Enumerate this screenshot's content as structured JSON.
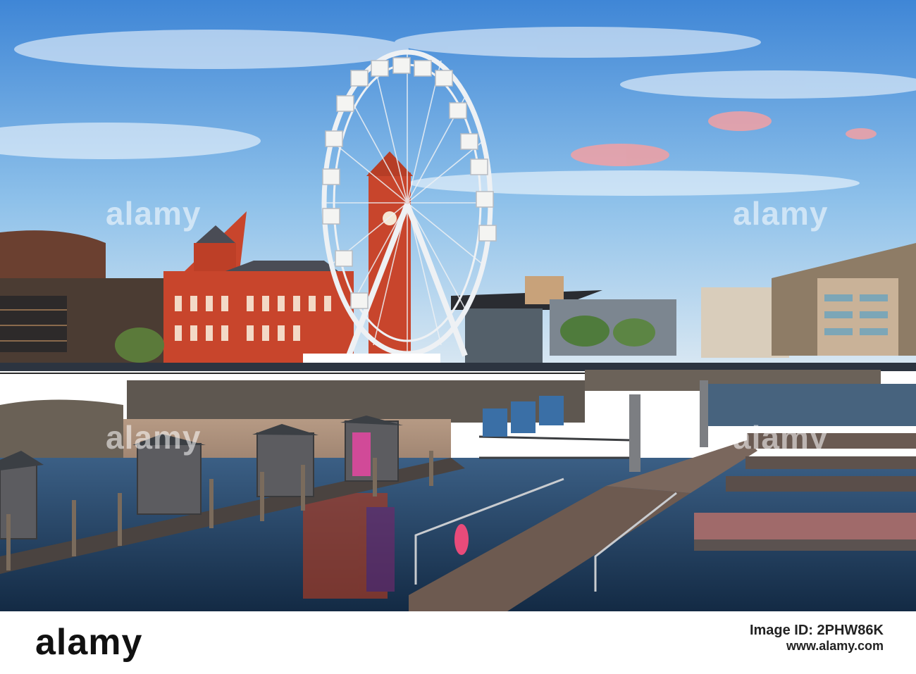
{
  "watermark": {
    "text": "alamy"
  },
  "footer": {
    "logo": "alamy",
    "image_id_line": "Image ID: 2PHW86K",
    "url": "www.alamy.com"
  },
  "scene": {
    "sky_color": "#5a9ad8",
    "building_color": "#c8452c",
    "water_color": "#1e3a5a"
  }
}
